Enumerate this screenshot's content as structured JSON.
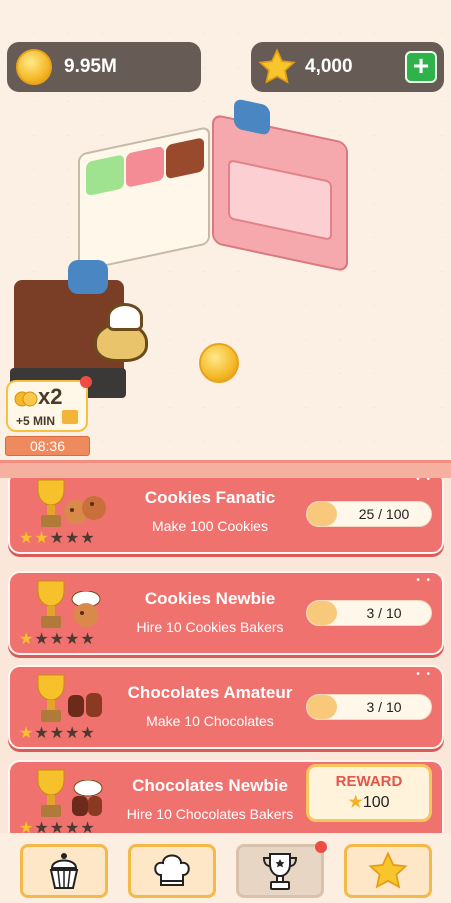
{
  "hud": {
    "coins": "9.95M",
    "stars": "4,000",
    "coin_icon": "gold-coin-icon",
    "star_icon": "star-icon",
    "add_icon": "plus-icon"
  },
  "boost": {
    "multiplier": "x2",
    "duration": "+5 MIN",
    "timer": "08:36"
  },
  "achievements": [
    {
      "title": "Cookies Fanatic",
      "description": "Make 100 Cookies",
      "progress": "25 / 100",
      "stars_earned": 2,
      "stars_total": 5,
      "icon": "cookies-icon"
    },
    {
      "title": "Cookies Newbie",
      "description": "Hire 10 Cookies Bakers",
      "progress": "3 / 10",
      "stars_earned": 1,
      "stars_total": 5,
      "icon": "cookies-baker-icon"
    },
    {
      "title": "Chocolates Amateur",
      "description": "Make 10 Chocolates",
      "progress": "3 / 10",
      "stars_earned": 1,
      "stars_total": 5,
      "icon": "chocolates-icon"
    },
    {
      "title": "Chocolates Newbie",
      "description": "Hire 10 Chocolates Bakers",
      "reward_label": "REWARD",
      "reward_amount": "100",
      "stars_earned": 1,
      "stars_total": 5,
      "icon": "chocolates-baker-icon"
    }
  ],
  "nav": [
    {
      "name": "cupcake",
      "icon": "cupcake-icon",
      "active": false
    },
    {
      "name": "chef",
      "icon": "chef-hat-icon",
      "active": false
    },
    {
      "name": "trophy",
      "icon": "trophy-icon",
      "active": true
    },
    {
      "name": "star",
      "icon": "star-icon",
      "active": false
    }
  ],
  "colors": {
    "card": "#f0726f",
    "accent_gold": "#f6c12a",
    "reward_text": "#e2574c",
    "plus_button": "#2fb24a"
  }
}
